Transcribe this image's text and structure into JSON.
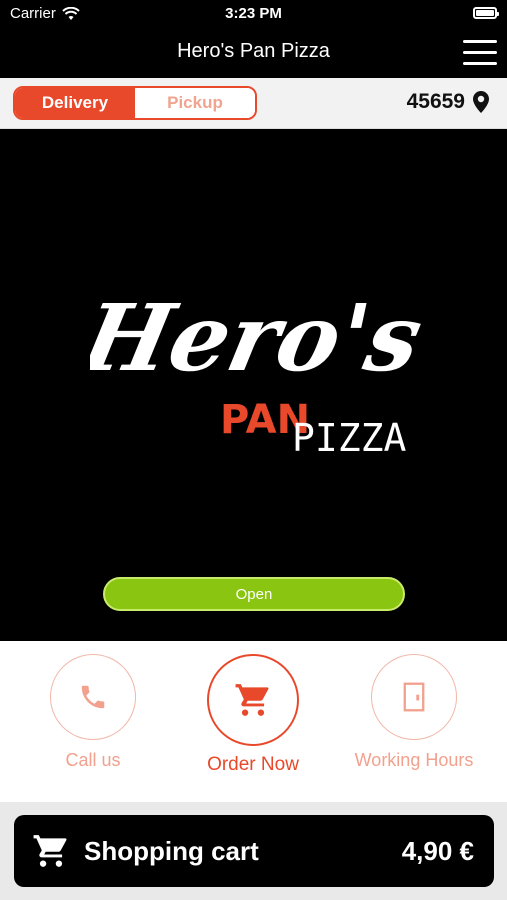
{
  "status_bar": {
    "carrier": "Carrier",
    "time": "3:23 PM"
  },
  "nav": {
    "title": "Hero's Pan Pizza",
    "menu_icon": "hamburger-menu-icon"
  },
  "order_mode": {
    "delivery": "Delivery",
    "pickup": "Pickup",
    "selected": "Delivery"
  },
  "location": {
    "zip": "45659",
    "icon": "location-pin-icon"
  },
  "logo": {
    "word1": "Hero's",
    "word2": "PAN",
    "word3": "PIZZA"
  },
  "status": {
    "label": "Open"
  },
  "actions": [
    {
      "label": "Call us",
      "icon": "phone-icon"
    },
    {
      "label": "Order Now",
      "icon": "cart-icon"
    },
    {
      "label": "Working Hours",
      "icon": "door-icon"
    }
  ],
  "cart": {
    "label": "Shopping cart",
    "total": "4,90 €",
    "icon": "cart-icon"
  },
  "colors": {
    "accent": "#e8492b",
    "open": "#8ac511",
    "light_accent": "#f1a18d"
  }
}
